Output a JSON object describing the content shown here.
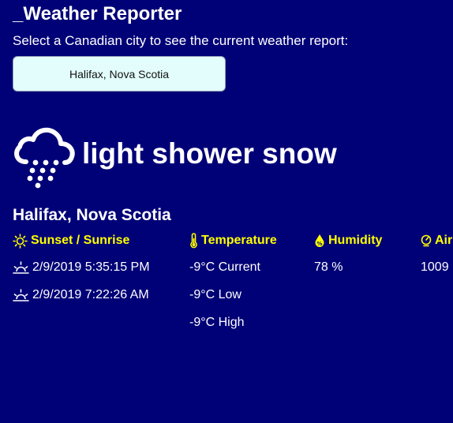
{
  "header": {
    "title": "_Weather Reporter",
    "instructions": "Select a Canadian city to see the current weather report:"
  },
  "city_select": {
    "selected": "Halifax, Nova Scotia"
  },
  "condition": {
    "icon": "snow-cloud-icon",
    "description": "light shower snow"
  },
  "location": {
    "name": "Halifax, Nova Scotia"
  },
  "columns": {
    "sun": {
      "icon": "sun-icon",
      "header": "Sunset / Sunrise",
      "sunset": "2/9/2019 5:35:15 PM",
      "sunrise": "2/9/2019 7:22:26 AM",
      "sunset_icon": "sunset-icon",
      "sunrise_icon": "sunrise-icon"
    },
    "temperature": {
      "icon": "thermometer-icon",
      "header": "Temperature",
      "current": "-9°C Current",
      "low": "-9°C Low",
      "high": "-9°C High"
    },
    "humidity": {
      "icon": "humidity-drop-icon",
      "header": "Humidity",
      "value": "78 %"
    },
    "pressure": {
      "icon": "pressure-gauge-icon",
      "header": "Air",
      "value": "1009"
    }
  },
  "colors": {
    "background": "#000077",
    "header_accent": "#ffff00",
    "select_background": "#e2fdfb"
  }
}
